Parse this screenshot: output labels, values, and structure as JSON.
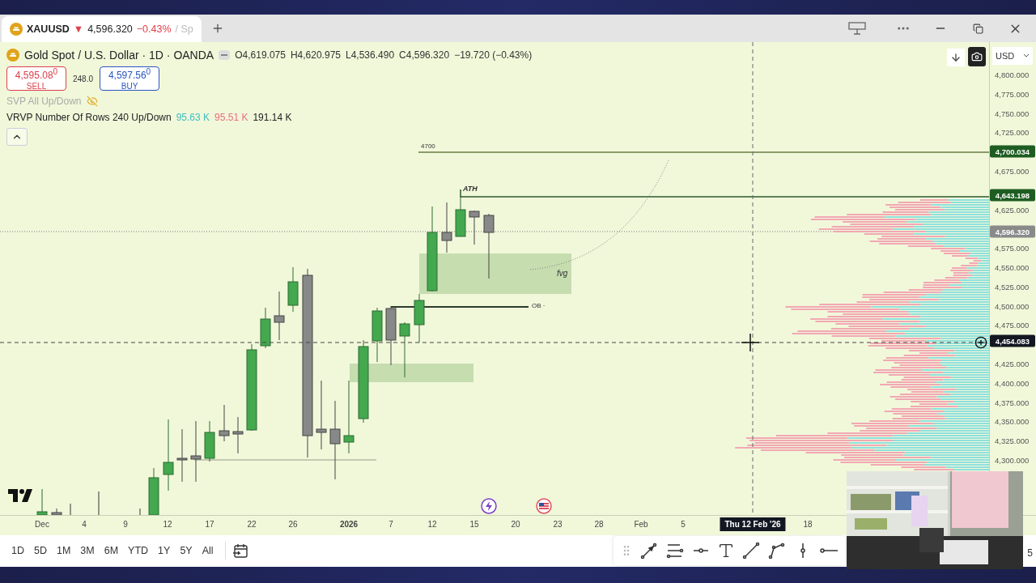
{
  "tab": {
    "symbol": "XAUUSD",
    "arrow": "▼",
    "price": "4,596.320",
    "change": "−0.43%",
    "suffix": "/ Sp",
    "selected": true
  },
  "legend": {
    "title": "Gold Spot / U.S. Dollar · 1D · OANDA",
    "ohlc": [
      {
        "label": "O",
        "value": "4,619.075"
      },
      {
        "label": "H",
        "value": "4,620.975"
      },
      {
        "label": "L",
        "value": "4,536.490"
      },
      {
        "label": "C",
        "value": "4,596.320"
      }
    ],
    "change": "−19.720 (−0.43%)"
  },
  "trade": {
    "sell": {
      "price": "4,595.08$^{0}$",
      "label": "SELL"
    },
    "spread": "248.0",
    "buy": {
      "price": "4,597.56$^{0}$",
      "label": "BUY"
    }
  },
  "indicators": [
    {
      "name": "SVP All Up/Down",
      "visible": false
    },
    {
      "name": "VRVP Number Of Rows 240 Up/Down",
      "visible": true,
      "values": [
        {
          "text": "95.63 K",
          "color": "#3fbcc0"
        },
        {
          "text": "95.51 K",
          "color": "#e8707e"
        },
        {
          "text": "191.14 K",
          "color": "#222222"
        }
      ]
    }
  ],
  "chart_labels": [
    {
      "text": "4700",
      "kind": "level"
    },
    {
      "text": "ATH",
      "kind": "tag"
    },
    {
      "text": "fvg",
      "kind": "zone"
    },
    {
      "text": "OB ·",
      "kind": "level"
    }
  ],
  "price_axis": {
    "currency": "USD",
    "ticks": [
      "4,800.000",
      "4,775.000",
      "4,750.000",
      "4,725.000",
      "4,675.000",
      "4,625.000",
      "4,575.000",
      "4,550.000",
      "4,525.000",
      "4,500.000",
      "4,475.000",
      "4,425.000",
      "4,400.000",
      "4,375.000",
      "4,350.000",
      "4,325.000",
      "4,300.000"
    ],
    "badges": [
      {
        "text": "4,700.034",
        "kind": "level"
      },
      {
        "text": "4,643.198",
        "kind": "level"
      },
      {
        "text": "4,596.320",
        "kind": "last"
      },
      {
        "text": "4,454.083",
        "kind": "crosshair"
      }
    ]
  },
  "time_axis": [
    {
      "text": "Dec",
      "kind": "month"
    },
    {
      "text": "4",
      "kind": "day"
    },
    {
      "text": "9",
      "kind": "day"
    },
    {
      "text": "12",
      "kind": "day"
    },
    {
      "text": "17",
      "kind": "day"
    },
    {
      "text": "22",
      "kind": "day"
    },
    {
      "text": "26",
      "kind": "day"
    },
    {
      "text": "2026",
      "kind": "year"
    },
    {
      "text": "7",
      "kind": "day"
    },
    {
      "text": "12",
      "kind": "day"
    },
    {
      "text": "15",
      "kind": "day"
    },
    {
      "text": "20",
      "kind": "day"
    },
    {
      "text": "23",
      "kind": "day"
    },
    {
      "text": "28",
      "kind": "day"
    },
    {
      "text": "Feb",
      "kind": "month"
    },
    {
      "text": "5",
      "kind": "day"
    },
    {
      "text": "Thu 12 Feb '26",
      "kind": "crosshair"
    },
    {
      "text": "18",
      "kind": "day"
    }
  ],
  "ranges": [
    {
      "label": "1D",
      "selected": false
    },
    {
      "label": "5D",
      "selected": false
    },
    {
      "label": "1M",
      "selected": false
    },
    {
      "label": "3M",
      "selected": false
    },
    {
      "label": "6M",
      "selected": false
    },
    {
      "label": "YTD",
      "selected": false
    },
    {
      "label": "1Y",
      "selected": false
    },
    {
      "label": "5Y",
      "selected": false
    },
    {
      "label": "All",
      "selected": false
    }
  ],
  "edge_text": "5"
}
